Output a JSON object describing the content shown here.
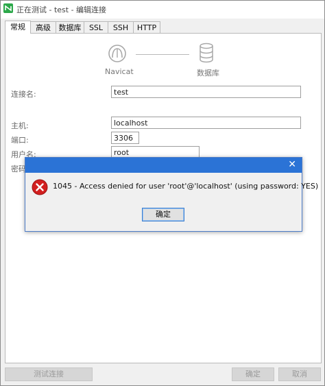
{
  "window": {
    "title": "正在测试 - test - 编辑连接"
  },
  "tabs": [
    {
      "label": "常规",
      "active": true
    },
    {
      "label": "高级"
    },
    {
      "label": "数据库"
    },
    {
      "label": "SSL"
    },
    {
      "label": "SSH"
    },
    {
      "label": "HTTP"
    }
  ],
  "diagram": {
    "left_label": "Navicat",
    "right_label": "数据库"
  },
  "form": {
    "conn_name": {
      "label": "连接名:",
      "value": "test"
    },
    "host": {
      "label": "主机:",
      "value": "localhost"
    },
    "port": {
      "label": "端口:",
      "value": "3306"
    },
    "user": {
      "label": "用户名:",
      "value": "root"
    },
    "password": {
      "label": "密码:"
    }
  },
  "dialog": {
    "message": "1045 - Access denied for user 'root'@'localhost' (using password: YES)",
    "ok_label": "确定"
  },
  "footer": {
    "test_label": "测试连接",
    "ok_label": "确定",
    "cancel_label": "取消"
  },
  "colors": {
    "dialog_titlebar": "#2b73d6",
    "error_red": "#d21f1f",
    "brand_green": "#2ca84a"
  }
}
